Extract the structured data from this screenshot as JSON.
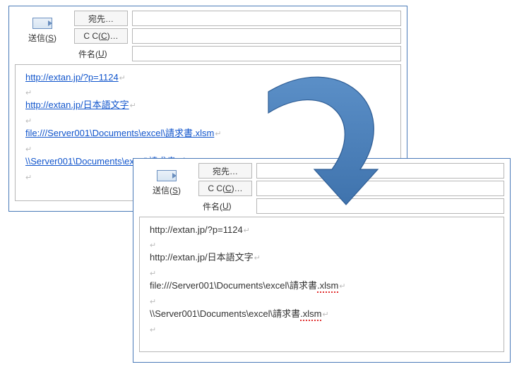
{
  "send_label_prefix": "送信(",
  "send_label_key": "S",
  "send_label_suffix": ")",
  "fields": {
    "to": "宛先…",
    "cc_prefix": "C C(",
    "cc_key": "C",
    "cc_suffix": ")…",
    "subject_prefix": "件名(",
    "subject_key": "U",
    "subject_suffix": ")"
  },
  "body_lines": [
    "http://extan.jp/?p=1124",
    "http://extan.jp/日本語文字",
    "file:///Server001\\Documents\\excel\\請求書.xlsm",
    "\\\\Server001\\Documents\\excel\\請求書.xlsm"
  ],
  "squiggly_parts": {
    "line2_tail": ".xlsm",
    "line3_tail": ".xlsm"
  }
}
